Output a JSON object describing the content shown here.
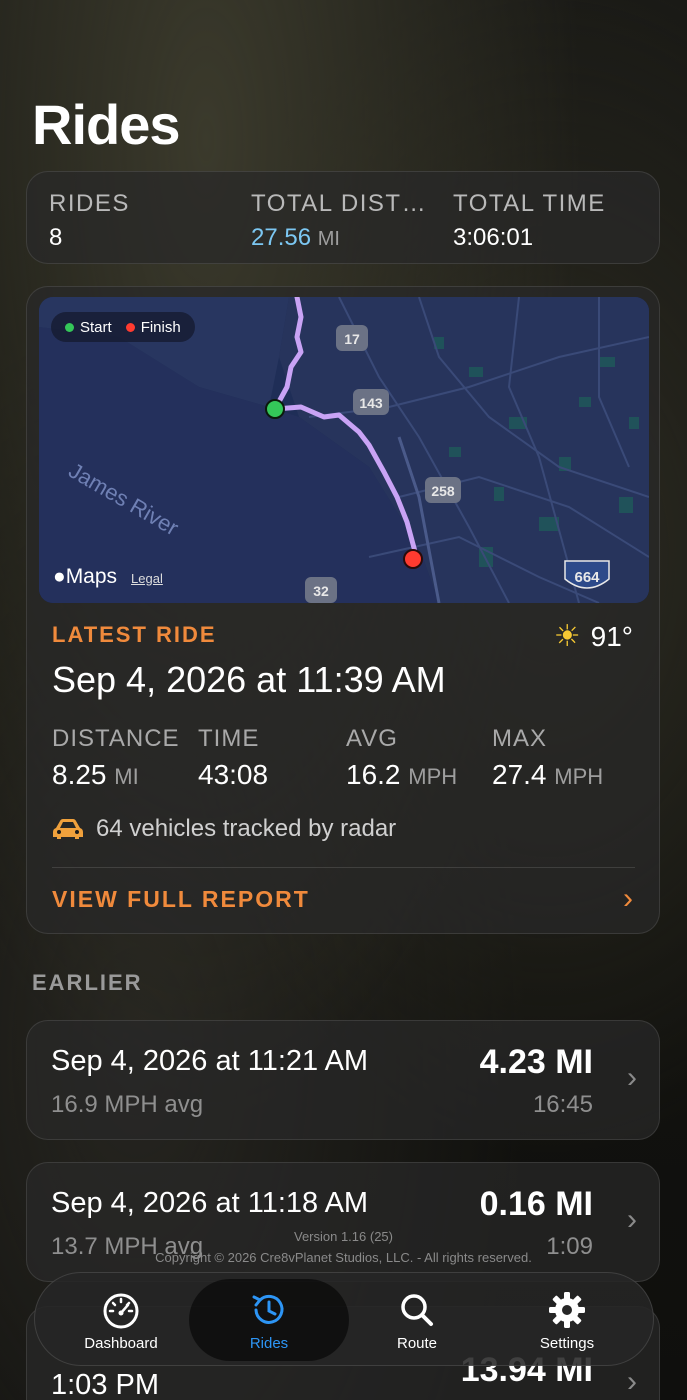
{
  "header": {
    "title": "Rides"
  },
  "summary": {
    "rides_label": "RIDES",
    "rides_value": "8",
    "distance_label": "TOTAL DIST…",
    "distance_value": "27.56",
    "distance_unit": "MI",
    "time_label": "TOTAL TIME",
    "time_value": "3:06:01"
  },
  "map": {
    "legend_start": "Start",
    "legend_finish": "Finish",
    "maps_brand": "Maps",
    "legal": "Legal",
    "river_label": "James River",
    "shields": [
      "17",
      "143",
      "258",
      "32",
      "664"
    ],
    "colors": {
      "start": "#34c759",
      "finish": "#ff3b30",
      "route": "#c9a3f5",
      "water": "#24305c"
    }
  },
  "latest": {
    "label": "LATEST RIDE",
    "temperature": "91°",
    "date": "Sep 4, 2026 at 11:39 AM",
    "distance_label": "DISTANCE",
    "distance_value": "8.25",
    "distance_unit": "MI",
    "time_label": "TIME",
    "time_value": "43:08",
    "avg_label": "AVG",
    "avg_value": "16.2",
    "avg_unit": "MPH",
    "max_label": "MAX",
    "max_value": "27.4",
    "max_unit": "MPH",
    "radar_text": "64 vehicles tracked by radar",
    "report_label": "VIEW FULL REPORT"
  },
  "earlier": {
    "section_label": "EARLIER",
    "rides": [
      {
        "date": "Sep 4, 2026 at 11:21 AM",
        "avg": "16.9 MPH avg",
        "distance": "4.23 MI",
        "duration": "16:45"
      },
      {
        "date": "Sep 4, 2026 at 11:18 AM",
        "avg": "13.7 MPH avg",
        "distance": "0.16 MI",
        "duration": "1:09"
      },
      {
        "date": "1:03 PM",
        "avg": "",
        "distance": "13.94 MI",
        "duration": ""
      }
    ]
  },
  "footer": {
    "version": "Version 1.16 (25)",
    "copyright": "Copyright © 2026 Cre8vPlanet Studios, LLC. - All rights reserved."
  },
  "tabs": [
    {
      "label": "Dashboard",
      "icon": "speedometer-icon"
    },
    {
      "label": "Rides",
      "icon": "history-icon"
    },
    {
      "label": "Route",
      "icon": "search-icon"
    },
    {
      "label": "Settings",
      "icon": "gear-icon"
    }
  ],
  "accent_color": "#f08a3c",
  "tab_active_color": "#2d95f5"
}
